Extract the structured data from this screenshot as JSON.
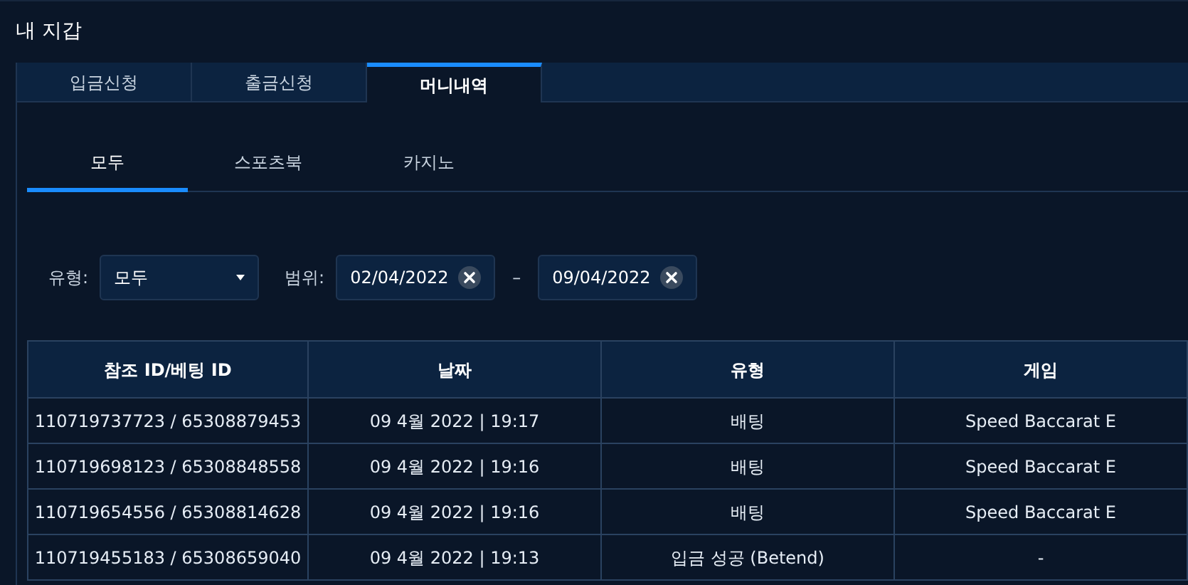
{
  "title": "내 지갑",
  "tabs": [
    {
      "label": "입금신청",
      "selected": false
    },
    {
      "label": "출금신청",
      "selected": false
    },
    {
      "label": "머니내역",
      "selected": true
    }
  ],
  "subtabs": [
    {
      "label": "모두",
      "selected": true
    },
    {
      "label": "스포츠북",
      "selected": false
    },
    {
      "label": "카지노",
      "selected": false
    }
  ],
  "filters": {
    "type_label": "유형:",
    "type_value": "모두",
    "range_label": "범위:",
    "date_from": "02/04/2022",
    "separator": "–",
    "date_to": "09/04/2022"
  },
  "table": {
    "columns": [
      "참조 ID/베팅 ID",
      "날짜",
      "유형",
      "게임"
    ],
    "rows": [
      [
        "110719737723 / 65308879453",
        "09 4월 2022 | 19:17",
        "배팅",
        "Speed Baccarat E"
      ],
      [
        "110719698123 / 65308848558",
        "09 4월 2022 | 19:16",
        "배팅",
        "Speed Baccarat E"
      ],
      [
        "110719654556 / 65308814628",
        "09 4월 2022 | 19:16",
        "배팅",
        "Speed Baccarat E"
      ],
      [
        "110719455183 / 65308659040",
        "09 4월 2022 | 19:13",
        "입금 성공 (Betend)",
        "-"
      ]
    ]
  }
}
